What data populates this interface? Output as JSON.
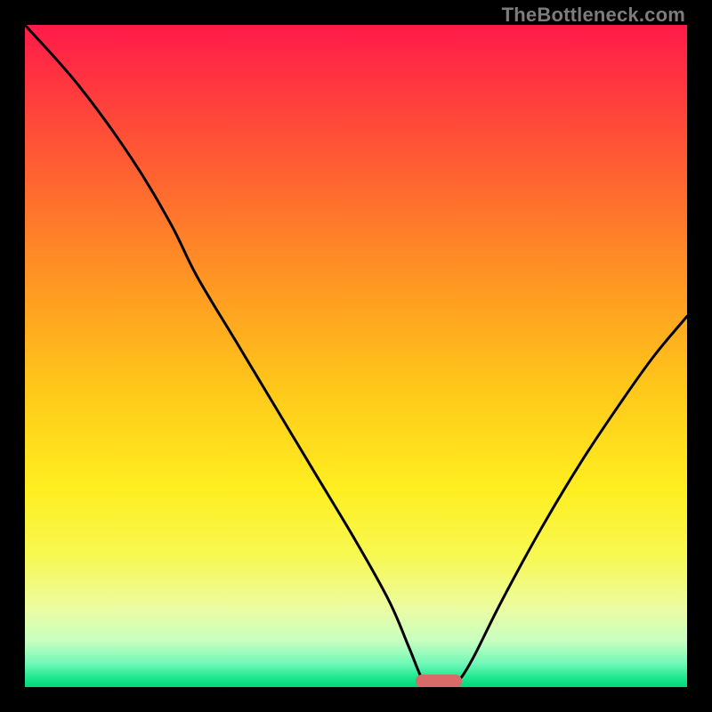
{
  "watermark": "TheBottleneck.com",
  "chart_data": {
    "type": "line",
    "title": "",
    "xlabel": "",
    "ylabel": "",
    "xlim": [
      0,
      100
    ],
    "ylim": [
      0,
      100
    ],
    "grid": false,
    "legend": false,
    "annotations": [],
    "background_gradient_stops": [
      {
        "pos": 0.0,
        "color": "#ff1a4a"
      },
      {
        "pos": 0.05,
        "color": "#ff2a44"
      },
      {
        "pos": 0.2,
        "color": "#ff5a33"
      },
      {
        "pos": 0.4,
        "color": "#ff9a22"
      },
      {
        "pos": 0.55,
        "color": "#ffc81a"
      },
      {
        "pos": 0.7,
        "color": "#ffee20"
      },
      {
        "pos": 0.8,
        "color": "#f7f850"
      },
      {
        "pos": 0.88,
        "color": "#ecfca0"
      },
      {
        "pos": 0.93,
        "color": "#c8ffc0"
      },
      {
        "pos": 0.965,
        "color": "#70f8b8"
      },
      {
        "pos": 0.985,
        "color": "#20e890"
      },
      {
        "pos": 1.0,
        "color": "#00d878"
      }
    ],
    "series": [
      {
        "name": "bottleneck-curve",
        "stroke": "#000000",
        "stroke_width": 3,
        "points": [
          {
            "x": 0,
            "y": 100
          },
          {
            "x": 8,
            "y": 91
          },
          {
            "x": 16,
            "y": 80
          },
          {
            "x": 22,
            "y": 70
          },
          {
            "x": 26,
            "y": 62
          },
          {
            "x": 32,
            "y": 52
          },
          {
            "x": 38,
            "y": 42
          },
          {
            "x": 44,
            "y": 32
          },
          {
            "x": 50,
            "y": 22
          },
          {
            "x": 55,
            "y": 13
          },
          {
            "x": 58,
            "y": 6
          },
          {
            "x": 60,
            "y": 1.2
          },
          {
            "x": 61,
            "y": 0.9
          },
          {
            "x": 63,
            "y": 0.9
          },
          {
            "x": 65,
            "y": 0.9
          },
          {
            "x": 66,
            "y": 1.6
          },
          {
            "x": 68,
            "y": 5
          },
          {
            "x": 72,
            "y": 13
          },
          {
            "x": 78,
            "y": 24
          },
          {
            "x": 84,
            "y": 34
          },
          {
            "x": 90,
            "y": 43
          },
          {
            "x": 95,
            "y": 50
          },
          {
            "x": 100,
            "y": 56
          }
        ]
      }
    ],
    "marker": {
      "name": "optimal-range-marker",
      "shape": "capsule",
      "fill": "#d86a6a",
      "x_start": 59,
      "x_end": 66,
      "y": 0.9,
      "height": 2.0
    }
  }
}
